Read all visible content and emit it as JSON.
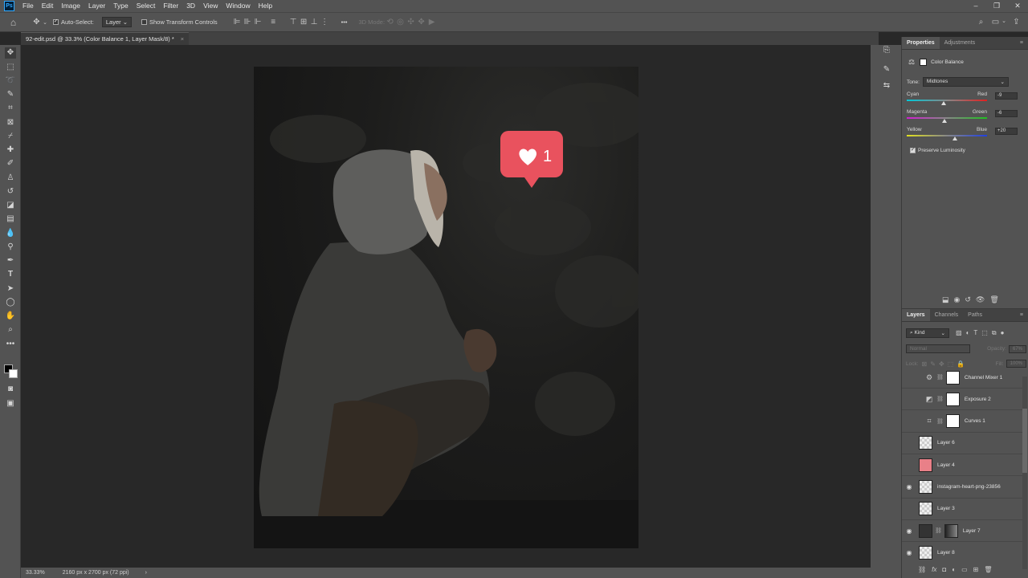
{
  "app": {
    "logo": "Ps"
  },
  "menu": [
    "File",
    "Edit",
    "Image",
    "Layer",
    "Type",
    "Select",
    "Filter",
    "3D",
    "View",
    "Window",
    "Help"
  ],
  "window_controls": [
    "–",
    "❐",
    "✕"
  ],
  "options_bar": {
    "auto_select_label": "Auto-Select:",
    "auto_select_checked": true,
    "target_value": "Layer",
    "transform_label": "Show Transform Controls",
    "mode_3d_label": "3D Mode:",
    "more": "•••"
  },
  "document_tab": {
    "title": "92-edit.psd @ 33.3% (Color Balance 1, Layer Mask/8) *",
    "close": "×"
  },
  "overlay_badge": {
    "count": "1"
  },
  "status": {
    "zoom": "33.33%",
    "doc_info": "2160 px x 2700 px (72 ppi)",
    "arrow": "›"
  },
  "properties": {
    "tabs": [
      "Properties",
      "Adjustments"
    ],
    "adjustment_title": "Color Balance",
    "tone_label": "Tone:",
    "tone_value": "Midtones",
    "sliders": [
      {
        "left": "Cyan",
        "right": "Red",
        "value": "-9",
        "level": 0.455,
        "color_left": "#00c8d8",
        "color_right": "#e02020"
      },
      {
        "left": "Magenta",
        "right": "Green",
        "value": "-6",
        "level": 0.47,
        "color_left": "#d020d0",
        "color_right": "#20c020"
      },
      {
        "left": "Yellow",
        "right": "Blue",
        "value": "+20",
        "level": 0.6,
        "color_left": "#e0e020",
        "color_right": "#2040e0"
      }
    ],
    "preserve_label": "Preserve Luminosity",
    "preserve_checked": true
  },
  "layers_panel": {
    "tabs": [
      "Layers",
      "Channels",
      "Paths"
    ],
    "filter_kind": "Kind",
    "blend_mode": "Normal",
    "opacity_label": "Opacity:",
    "opacity_value": "67%",
    "lock_label": "Lock:",
    "fill_label": "Fill:",
    "fill_value": "100%",
    "layers": [
      {
        "name": "Channel Mixer 1",
        "visible": false,
        "type": "adjustment",
        "icon": "channel-mixer-icon"
      },
      {
        "name": "Exposure 2",
        "visible": false,
        "type": "adjustment",
        "icon": "exposure-icon"
      },
      {
        "name": "Curves 1",
        "visible": false,
        "type": "adjustment",
        "icon": "curves-icon"
      },
      {
        "name": "Layer 6",
        "visible": false,
        "type": "pixel"
      },
      {
        "name": "Layer 4",
        "visible": false,
        "type": "pixel-red"
      },
      {
        "name": "instagram-heart-png-23856",
        "visible": true,
        "type": "smart"
      },
      {
        "name": "Layer 3",
        "visible": false,
        "type": "pixel"
      },
      {
        "name": "Layer 7",
        "visible": true,
        "type": "masked"
      },
      {
        "name": "Layer 8",
        "visible": true,
        "type": "pixel"
      }
    ]
  }
}
